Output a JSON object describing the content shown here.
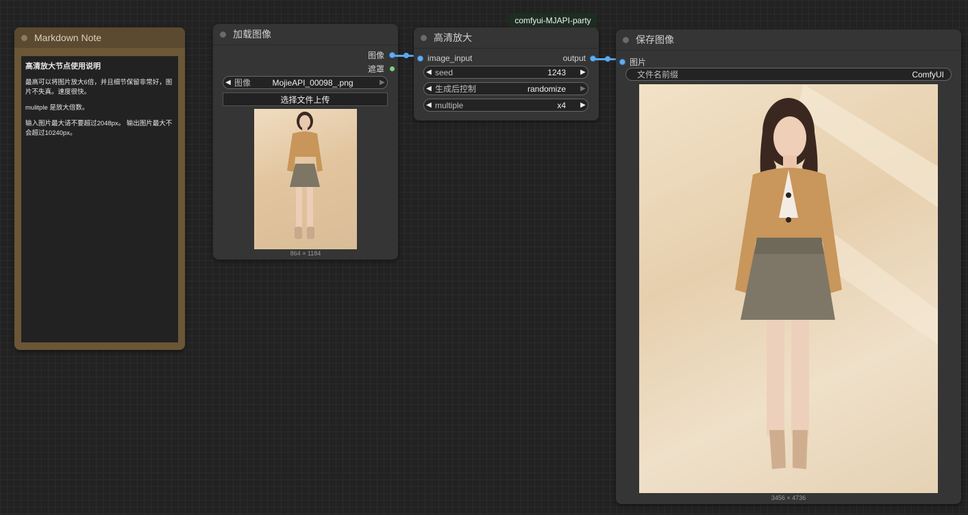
{
  "group": {
    "title": "comfyui-MJAPI-party"
  },
  "markdown_note": {
    "title": "Markdown Note",
    "heading": "高清放大节点使用说明",
    "para1": "最高可以将图片放大6倍，并且细节保留非常好，图片不失真。速度很快。",
    "para2": "mulitple 是放大倍数。",
    "para3": "输入图片最大请不要超过2048px。 输出图片最大不会超过10240px。"
  },
  "load_image": {
    "title": "加载图像",
    "output_image": "图像",
    "output_mask": "遮罩",
    "image_label": "图像",
    "image_value": "MojieAPI_00098_.png",
    "upload_button": "选择文件上传",
    "dimensions": "864 × 1184"
  },
  "upscale": {
    "title": "高清放大",
    "input_label": "image_input",
    "output_label": "output",
    "seed_label": "seed",
    "seed_value": "1243",
    "control_label": "生成后控制",
    "control_value": "randomize",
    "multiple_label": "multiple",
    "multiple_value": "x4"
  },
  "save_image": {
    "title": "保存图像",
    "input_label": "图片",
    "prefix_label": "文件名前缀",
    "prefix_value": "ComfyUI",
    "dimensions": "3456 × 4736"
  },
  "colors": {
    "canvas": "#222222",
    "node": "#353535",
    "link": "#5aa9ef",
    "note_frame": "#6b5636"
  }
}
